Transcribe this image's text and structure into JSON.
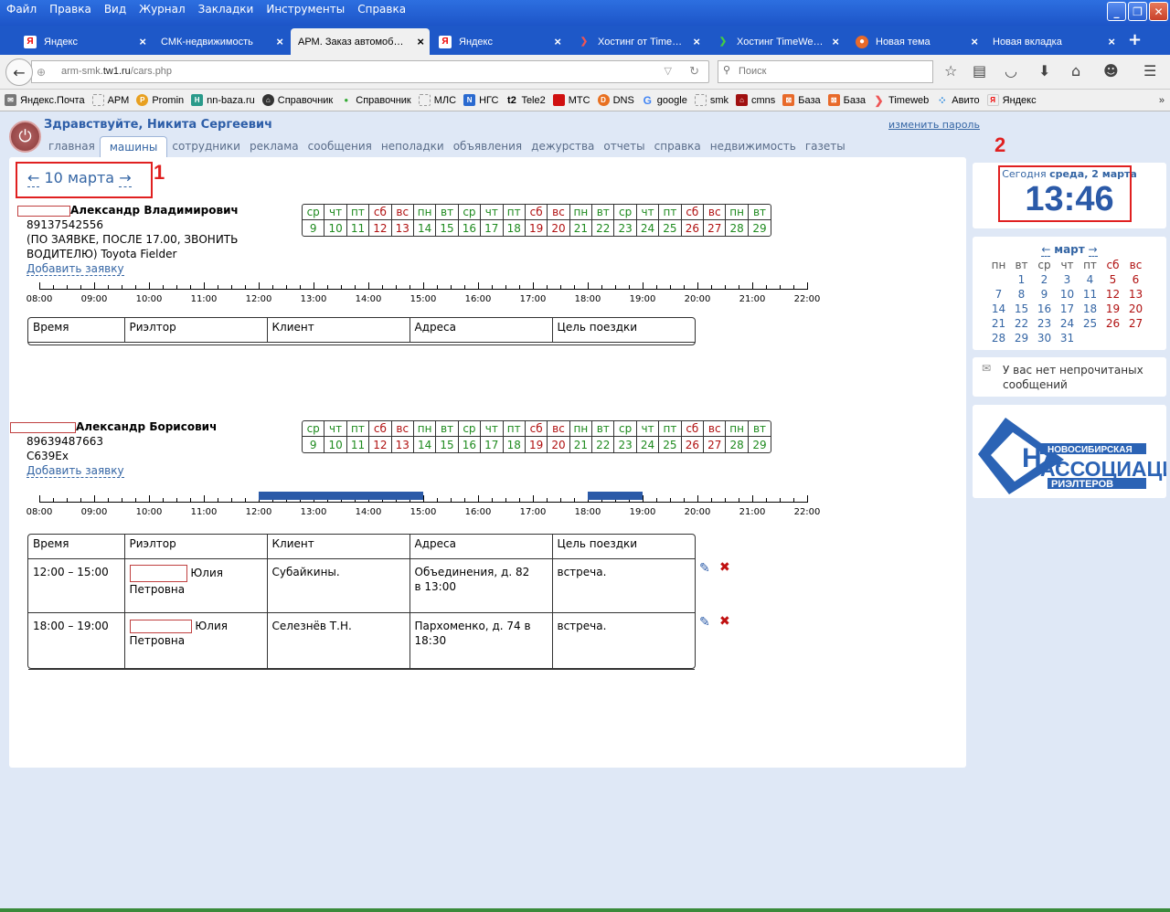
{
  "browser": {
    "menu": [
      "Файл",
      "Правка",
      "Вид",
      "Журнал",
      "Закладки",
      "Инструменты",
      "Справка"
    ],
    "tabs": [
      {
        "label": "Яндекс",
        "icon": "yandex-icon"
      },
      {
        "label": "СМК-недвижимость",
        "icon": ""
      },
      {
        "label": "АРМ. Заказ автомоб…",
        "icon": ""
      },
      {
        "label": "Яндекс",
        "icon": "yandex-icon"
      },
      {
        "label": "Хостинг от Time…",
        "icon": "timeweb-icon"
      },
      {
        "label": "Хостинг TimeWe…",
        "icon": "timeweb-icon"
      },
      {
        "label": "Новая тема",
        "icon": "firefox-icon"
      },
      {
        "label": "Новая вкладка",
        "icon": ""
      }
    ],
    "url_prefix": "arm-smk.",
    "url_domain": "tw1.ru",
    "url_path": "/cars.php",
    "search_placeholder": "Поиск",
    "bookmarks": [
      "Яндекс.Почта",
      "АРМ",
      "Promin",
      "nn-baza.ru",
      "Справочник",
      "Справочник",
      "МЛС",
      "НГС",
      "Tele2",
      "МТС",
      "DNS",
      "google",
      "smk",
      "cmns",
      "База",
      "База",
      "Timeweb",
      "Авито",
      "Яндекс"
    ]
  },
  "header": {
    "greeting": "Здравствуйте, Никита Сергеевич",
    "change_password": "изменить пароль"
  },
  "nav": [
    "главная",
    "машины",
    "сотрудники",
    "реклама",
    "сообщения",
    "неполадки",
    "объявления",
    "дежурства",
    "отчеты",
    "справка",
    "недвижимость",
    "газеты"
  ],
  "date_nav": {
    "prev": "←",
    "date": "10 марта",
    "next": "→"
  },
  "annotations": {
    "one": "1",
    "two": "2"
  },
  "week_days": [
    "ср",
    "чт",
    "пт",
    "сб",
    "вс",
    "пн",
    "вт",
    "ср",
    "чт",
    "пт",
    "сб",
    "вс",
    "пн",
    "вт",
    "ср",
    "чт",
    "пт",
    "сб",
    "вс",
    "пн",
    "вт"
  ],
  "week_dates": [
    "9",
    "10",
    "11",
    "12",
    "13",
    "14",
    "15",
    "16",
    "17",
    "18",
    "19",
    "20",
    "21",
    "22",
    "23",
    "24",
    "25",
    "26",
    "27",
    "28",
    "29"
  ],
  "hours": [
    "08:00",
    "09:00",
    "10:00",
    "11:00",
    "12:00",
    "13:00",
    "14:00",
    "15:00",
    "16:00",
    "17:00",
    "18:00",
    "19:00",
    "20:00",
    "21:00",
    "22:00"
  ],
  "table_headers": [
    "Время",
    "Риэлтор",
    "Клиент",
    "Адреса",
    "Цель поездки"
  ],
  "drivers": [
    {
      "name": "Александр Владимирович",
      "phone": "89137542556",
      "note1": "(ПО ЗАЯВКЕ, ПОСЛЕ 17.00, ЗВОНИТЬ",
      "note2": "ВОДИТЕЛЮ) Toyota Fielder",
      "add": "Добавить заявку",
      "busy": [],
      "orders": []
    },
    {
      "name": "Александр Борисович",
      "phone": "89639487663",
      "note1": "С639Ех",
      "note2": "",
      "add": "Добавить заявку",
      "busy": [
        {
          "from": 12,
          "to": 15
        },
        {
          "from": 18,
          "to": 19
        }
      ],
      "orders": [
        {
          "time": "12:00 – 15:00",
          "realtor1": "Юлия",
          "realtor2": "Петровна",
          "client": "Субайкины.",
          "addr1": "Объединения, д. 82",
          "addr2": "в 13:00",
          "goal": "встреча."
        },
        {
          "time": "18:00 – 19:00",
          "realtor1": "Юлия",
          "realtor2": "Петровна",
          "client": "Селезнёв Т.Н.",
          "addr1": "Пархоменко, д. 74 в",
          "addr2": "18:30",
          "goal": "встреча."
        }
      ]
    }
  ],
  "sidebar": {
    "today_label": "Сегодня",
    "today_date": "среда, 2 марта",
    "clock": "13:46",
    "cal_prev": "←",
    "cal_month": "март",
    "cal_next": "→",
    "cal_head": [
      "пн",
      "вт",
      "ср",
      "чт",
      "пт",
      "сб",
      "вс"
    ],
    "cal_rows": [
      [
        "",
        "1",
        "2",
        "3",
        "4",
        "5",
        "6"
      ],
      [
        "7",
        "8",
        "9",
        "10",
        "11",
        "12",
        "13"
      ],
      [
        "14",
        "15",
        "16",
        "17",
        "18",
        "19",
        "20"
      ],
      [
        "21",
        "22",
        "23",
        "24",
        "25",
        "26",
        "27"
      ],
      [
        "28",
        "29",
        "30",
        "31",
        "",
        "",
        ""
      ]
    ],
    "messages": "У вас нет непрочитаных сообщений",
    "logo_line1": "НОВОСИБИРСКАЯ",
    "logo_line2": "АССОЦИАЦИЯ",
    "logo_line3": "РИЭЛТЕРОВ"
  }
}
